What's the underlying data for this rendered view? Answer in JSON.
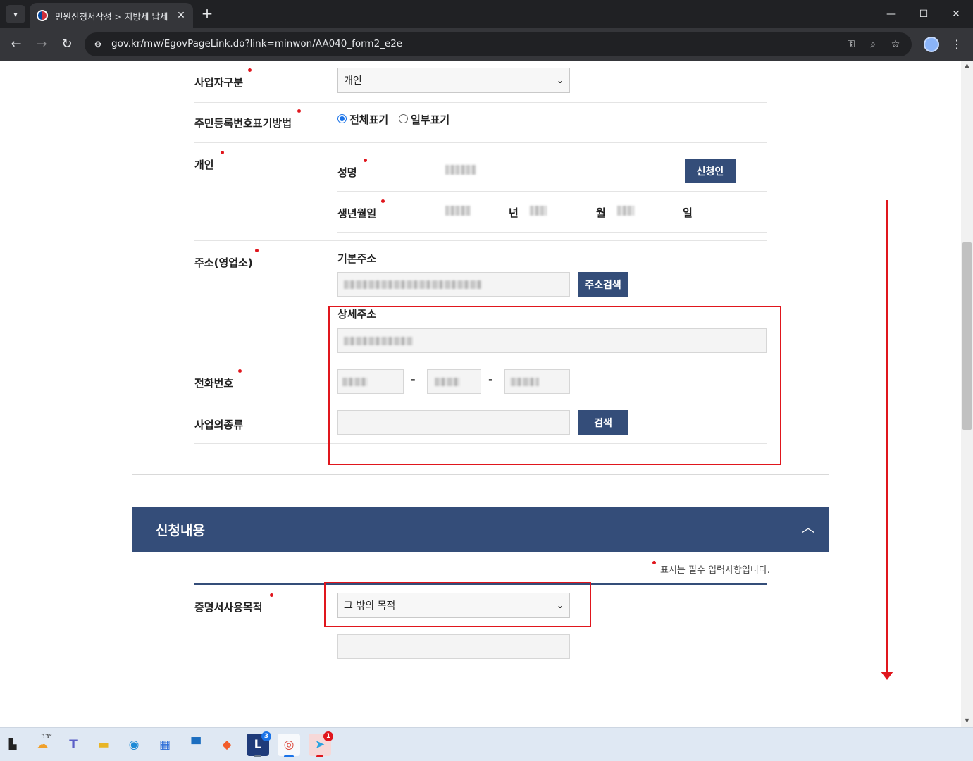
{
  "browser": {
    "tab_title": "민원신청서작성 > 지방세 납세",
    "url": "gov.kr/mw/EgovPageLink.do?link=minwon/AA040_form2_e2e"
  },
  "form": {
    "business_type": {
      "label": "사업자구분",
      "value": "개인"
    },
    "rrn_display": {
      "label": "주민등록번호표기방법",
      "option_full": "전체표기",
      "option_partial": "일부표기"
    },
    "individual": {
      "label": "개인",
      "name_label": "성명",
      "applicant_button": "신청인",
      "birth_label": "생년월일",
      "year_unit": "년",
      "month_unit": "월",
      "day_unit": "일"
    },
    "address": {
      "label": "주소(영업소)",
      "basic_label": "기본주소",
      "search_button": "주소검색",
      "detail_label": "상세주소"
    },
    "phone": {
      "label": "전화번호",
      "separator": "-"
    },
    "business_kind": {
      "label": "사업의종류",
      "search_button": "검색"
    }
  },
  "application": {
    "title": "신청내용",
    "required_note": "표시는 필수 입력사항입니다.",
    "purpose": {
      "label": "증명서사용목적",
      "value": "그 밖의 목적"
    }
  },
  "taskbar": {
    "weather_temp": "33°",
    "launcher_badge": "3",
    "telegram_badge": "1"
  },
  "colors": {
    "navy": "#344d79",
    "required_dot": "#e0161d",
    "annotation": "#e0161d"
  }
}
